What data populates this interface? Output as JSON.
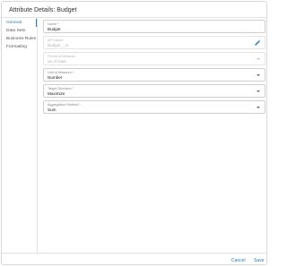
{
  "dialog": {
    "title": "Attribute Details: Budget"
  },
  "sidebar": {
    "items": [
      {
        "label": "General"
      },
      {
        "label": "Data Sets"
      },
      {
        "label": "Business Rules"
      },
      {
        "label": "Formatting"
      }
    ]
  },
  "fields": {
    "name": {
      "label": "Name *",
      "value": "Budget"
    },
    "api_name": {
      "label": "API Name",
      "value": "Budget__m"
    },
    "period_of_measure": {
      "label": "Period of Measure",
      "value": "as of Date"
    },
    "unit_of_measure": {
      "label": "Unit of Measure *",
      "value": "Number"
    },
    "target_direction": {
      "label": "Target Direction *",
      "value": "Maximize"
    },
    "aggregation_method": {
      "label": "Aggregation Method *",
      "value": "Sum"
    }
  },
  "footer": {
    "cancel_label": "Cancel",
    "save_label": "Save"
  },
  "colors": {
    "accent": "#2a7ab8",
    "border": "#cfcfcf",
    "disabled_text": "#b5b5b5"
  },
  "icons": {
    "api_name_action": "pencil-icon",
    "select_caret": "chevron-down-icon"
  }
}
